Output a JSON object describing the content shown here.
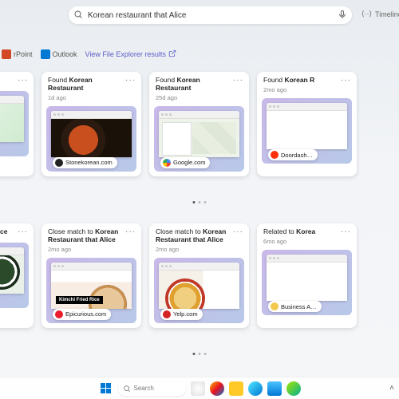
{
  "search": {
    "query": "Korean restaurant that Alice",
    "placeholder": "Search"
  },
  "timeline": {
    "label": "Timeline"
  },
  "filters": {
    "powerpoint": "rPoint",
    "outlook": "Outlook",
    "file_explorer": "View File Explorer results"
  },
  "row1": [
    {
      "title_prefix": "",
      "title_bold": "",
      "title_suffix": "",
      "age": "",
      "source": "",
      "thumb": "green"
    },
    {
      "title_prefix": "Found ",
      "title_bold": "Korean Restaurant",
      "title_suffix": "",
      "age": "1d ago",
      "source": "Stonekorean.com",
      "thumb": "stone",
      "chip": "c-stone"
    },
    {
      "title_prefix": "Found ",
      "title_bold": "Korean Restaurant",
      "title_suffix": "",
      "age": "25d ago",
      "source": "Google.com",
      "thumb": "map",
      "chip": "c-google"
    },
    {
      "title_prefix": "Found ",
      "title_bold": "Korean R",
      "title_suffix": "",
      "age": "2mo ago",
      "source": "Doordash…",
      "thumb": "dd",
      "chip": "c-dd"
    }
  ],
  "row2": [
    {
      "title_prefix": "",
      "title_bold": "ce",
      "title_suffix": "",
      "age": "",
      "source": "",
      "thumb": "mag"
    },
    {
      "title_prefix": "Close match to ",
      "title_bold": "Korean Restaurant that Alice",
      "title_suffix": "",
      "age": "2mo ago",
      "source": "Epicurious.com",
      "thumb": "kimchi",
      "chip": "c-epi"
    },
    {
      "title_prefix": "Close match to ",
      "title_bold": "Korean Restaurant that Alice",
      "title_suffix": "",
      "age": "2mo ago",
      "source": "Yelp.com",
      "thumb": "yelp",
      "chip": "c-yelp"
    },
    {
      "title_prefix": "Related to ",
      "title_bold": "Korea",
      "title_suffix": "",
      "age": "6mo ago",
      "source": "Business A…",
      "thumb": "biz",
      "chip": "c-biz"
    }
  ],
  "kimchi_overlay": "Kimchi Fried Rice",
  "taskbar": {
    "search": "Search"
  }
}
